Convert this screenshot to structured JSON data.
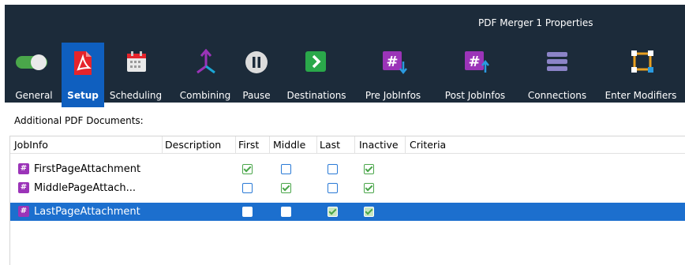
{
  "window": {
    "title": "PDF Merger 1 Properties"
  },
  "toolbar": {
    "items": [
      {
        "label": "General",
        "icon": "toggle-icon"
      },
      {
        "label": "Setup",
        "icon": "pdf-icon",
        "active": true
      },
      {
        "label": "Scheduling",
        "icon": "calendar-icon"
      },
      {
        "label": "Combining",
        "icon": "merge-icon"
      },
      {
        "label": "Pause",
        "icon": "pause-icon"
      },
      {
        "label": "Destinations",
        "icon": "arrow-right-icon"
      },
      {
        "label": "Pre JobInfos",
        "icon": "hash-down-icon"
      },
      {
        "label": "Post JobInfos",
        "icon": "hash-up-icon"
      },
      {
        "label": "Connections",
        "icon": "stack-icon"
      },
      {
        "label": "Enter Modifiers",
        "icon": "modifier-icon"
      }
    ]
  },
  "section": {
    "label": "Additional PDF Documents:"
  },
  "table": {
    "columns": [
      "JobInfo",
      "Description",
      "First",
      "Middle",
      "Last",
      "Inactive",
      "Criteria"
    ],
    "rows": [
      {
        "name": "FirstPageAttachment",
        "first": true,
        "middle": false,
        "last": false,
        "inactive": true,
        "selected": false
      },
      {
        "name": "MiddlePageAttach...",
        "first": false,
        "middle": true,
        "last": false,
        "inactive": true,
        "selected": false
      },
      {
        "name": "LastPageAttachment",
        "first": false,
        "middle": false,
        "last": true,
        "inactive": true,
        "selected": true
      }
    ]
  },
  "colors": {
    "topbar": "#1c2b3a",
    "accent": "#0f5fbf",
    "selection": "#1c6fce",
    "purple": "#9b34b8",
    "check": "#4aa64a"
  }
}
